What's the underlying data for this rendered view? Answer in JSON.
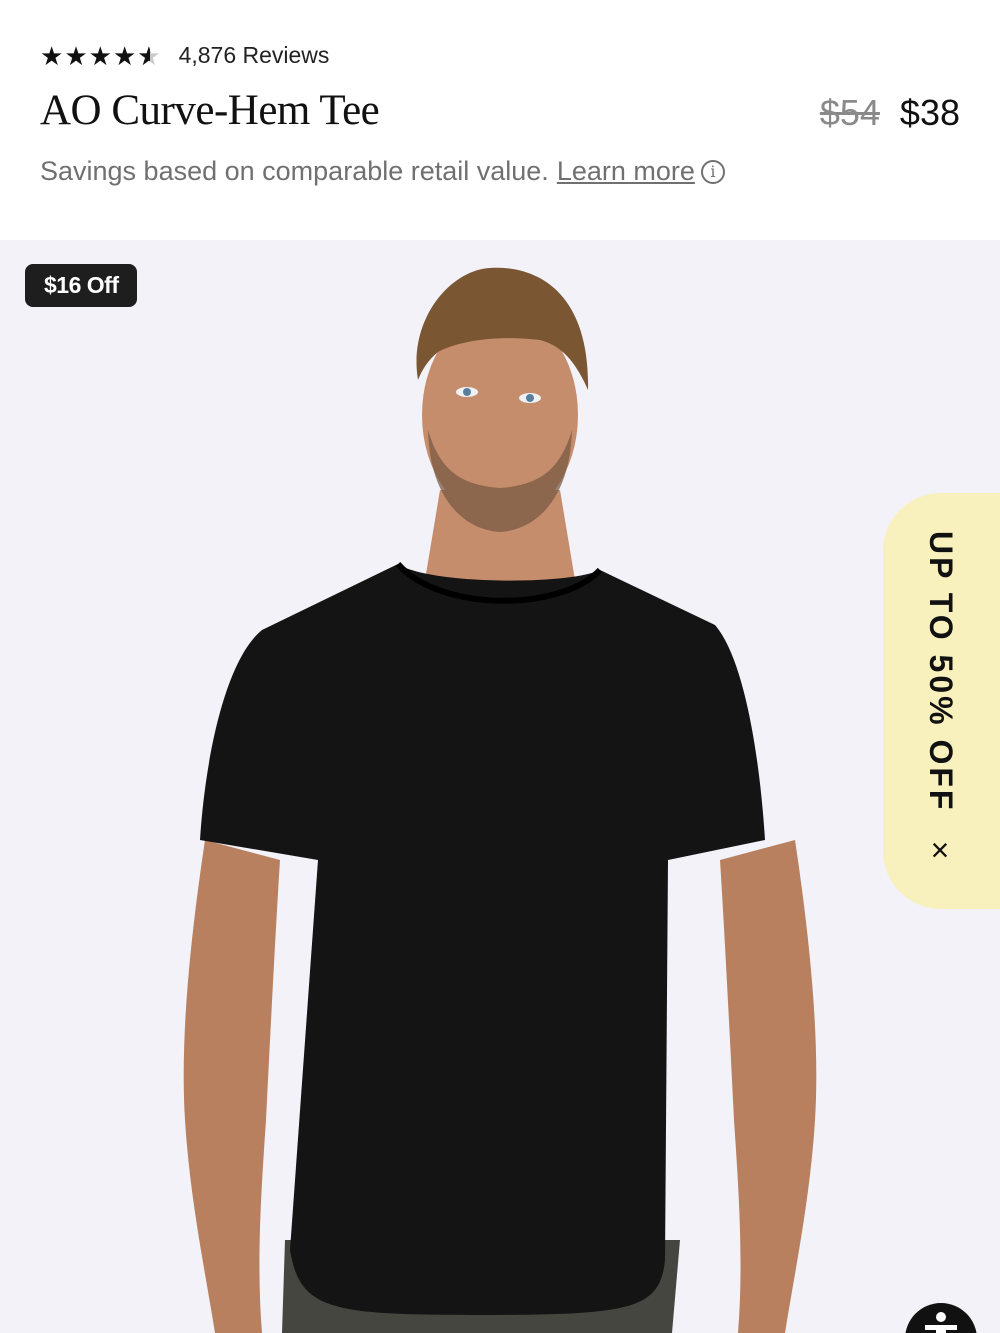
{
  "product": {
    "rating_value": 4.5,
    "reviews_text": "4,876 Reviews",
    "title": "AO Curve-Hem Tee",
    "original_price": "$54",
    "sale_price": "$38",
    "savings_text": "Savings based on comparable retail value.",
    "learn_more": "Learn more"
  },
  "hero": {
    "badge": "$16 Off",
    "promo_text": "UP TO 50% OFF",
    "promo_close": "×",
    "background_color": "#f2f2f8",
    "promo_color": "#f8f1bd",
    "shirt_color": "#141414"
  },
  "icons": {
    "info": "info-icon",
    "close": "close-icon",
    "accessibility": "accessibility-icon",
    "star": "star-icon"
  }
}
